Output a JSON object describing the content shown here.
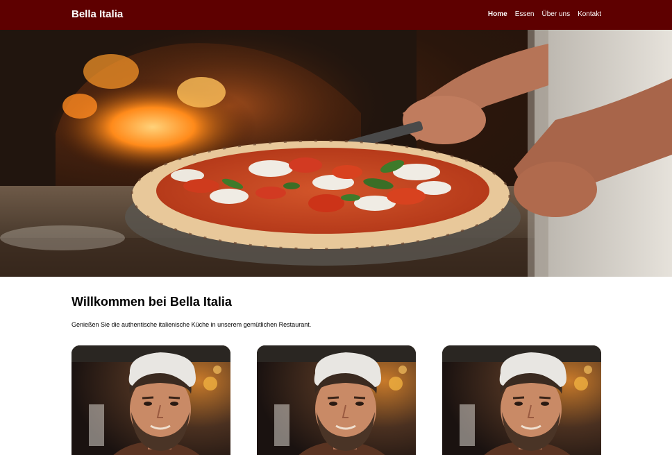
{
  "header": {
    "brand": "Bella Italia",
    "nav": [
      {
        "label": "Home",
        "active": true
      },
      {
        "label": "Essen",
        "active": false
      },
      {
        "label": "Über uns",
        "active": false
      },
      {
        "label": "Kontakt",
        "active": false
      }
    ]
  },
  "hero": {
    "image": "pizza-oven-chef-photo"
  },
  "welcome": {
    "title": "Willkommen bei Bella Italia",
    "text": "Genießen Sie die authentische italienische Küche in unserem gemütlichen Restaurant."
  },
  "cards": [
    {
      "image": "chef-portrait-photo"
    },
    {
      "image": "chef-portrait-photo"
    },
    {
      "image": "chef-portrait-photo"
    }
  ],
  "colors": {
    "header_bg": "#5e0000",
    "header_text": "#ffffff",
    "page_bg": "#ffffff"
  }
}
